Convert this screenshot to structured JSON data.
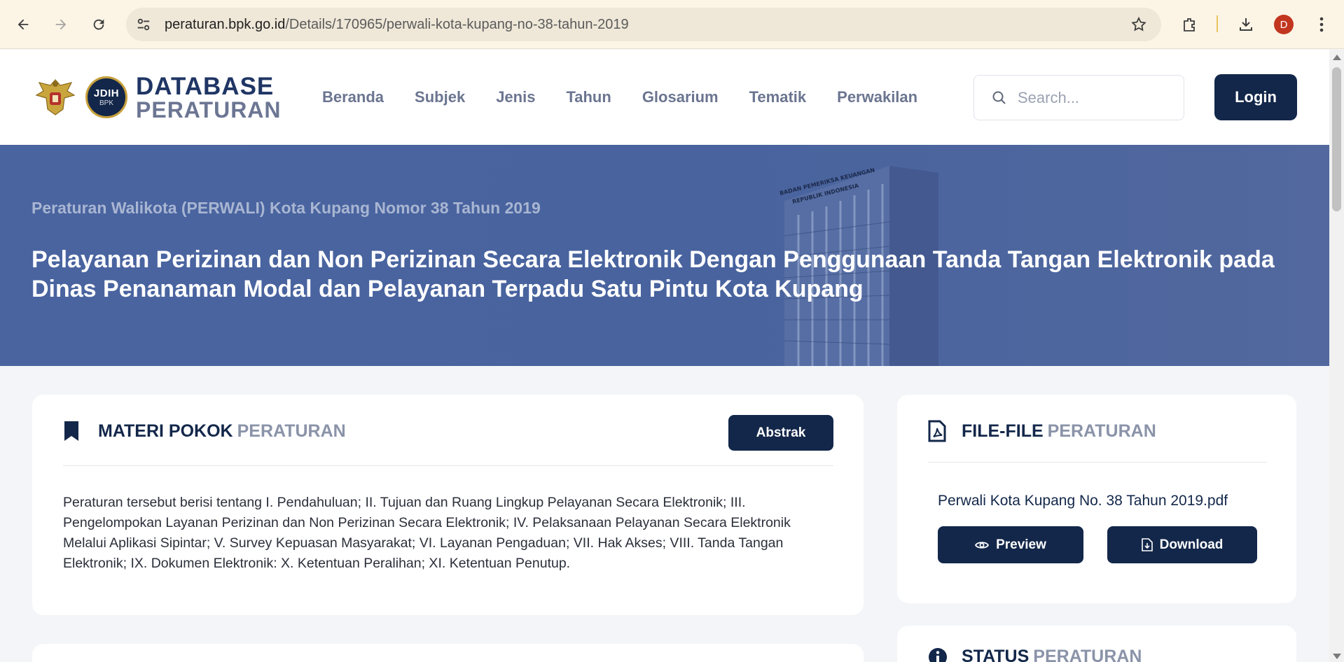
{
  "browser": {
    "url_host": "peraturan.bpk.go.id",
    "url_path": "/Details/170965/perwali-kota-kupang-no-38-tahun-2019",
    "avatar_letter": "D",
    "icons": [
      "back-icon",
      "forward-icon",
      "reload-icon",
      "site-settings-icon",
      "bookmark-star-icon",
      "extensions-icon",
      "download-icon",
      "menu-dots-icon"
    ]
  },
  "header": {
    "logo": {
      "jdih_top": "JDIH",
      "jdih_bottom": "BPK",
      "line1": "DATABASE",
      "line2": "PERATURAN"
    },
    "nav": [
      "Beranda",
      "Subjek",
      "Jenis",
      "Tahun",
      "Glosarium",
      "Tematik",
      "Perwakilan"
    ],
    "search_placeholder": "Search...",
    "login_label": "Login"
  },
  "hero": {
    "subtitle": "Peraturan Walikota (PERWALI) Kota Kupang Nomor 38 Tahun 2019",
    "title": "Pelayanan Perizinan dan Non Perizinan Secara Elektronik Dengan Penggunaan Tanda Tangan Elektronik pada Dinas Penanaman Modal dan Pelayanan Terpadu Satu Pintu Kota Kupang",
    "building_sign_line1": "BADAN PEMERIKSA KEUANGAN",
    "building_sign_line2": "REPUBLIK INDONESIA"
  },
  "materi": {
    "title": "MATERI POKOK",
    "title_sub": "PERATURAN",
    "abstrak_label": "Abstrak",
    "body": "Peraturan tersebut berisi tentang I. Pendahuluan; II. Tujuan dan Ruang Lingkup Pelayanan Secara Elektronik; III. Pengelompokan Layanan Perizinan dan Non Perizinan Secara Elektronik; IV. Pelaksanaan Pelayanan Secara Elektronik Melalui Aplikasi Sipintar; V. Survey Kepuasan Masyarakat; VI. Layanan Pengaduan; VII. Hak Akses; VIII. Tanda Tangan Elektronik; IX. Dokumen Elektronik: X. Ketentuan Peralihan; XI. Ketentuan Penutup."
  },
  "files": {
    "title": "FILE-FILE",
    "title_sub": "PERATURAN",
    "file_name": "Perwali Kota Kupang No. 38 Tahun 2019.pdf",
    "preview_label": "Preview",
    "download_label": "Download"
  },
  "status": {
    "title": "STATUS",
    "title_sub": "PERATURAN"
  },
  "colors": {
    "navy": "#13274a",
    "hero_blue": "#4a64a0",
    "muted": "#8a93a8",
    "chrome_bg": "#fcf5e6"
  }
}
